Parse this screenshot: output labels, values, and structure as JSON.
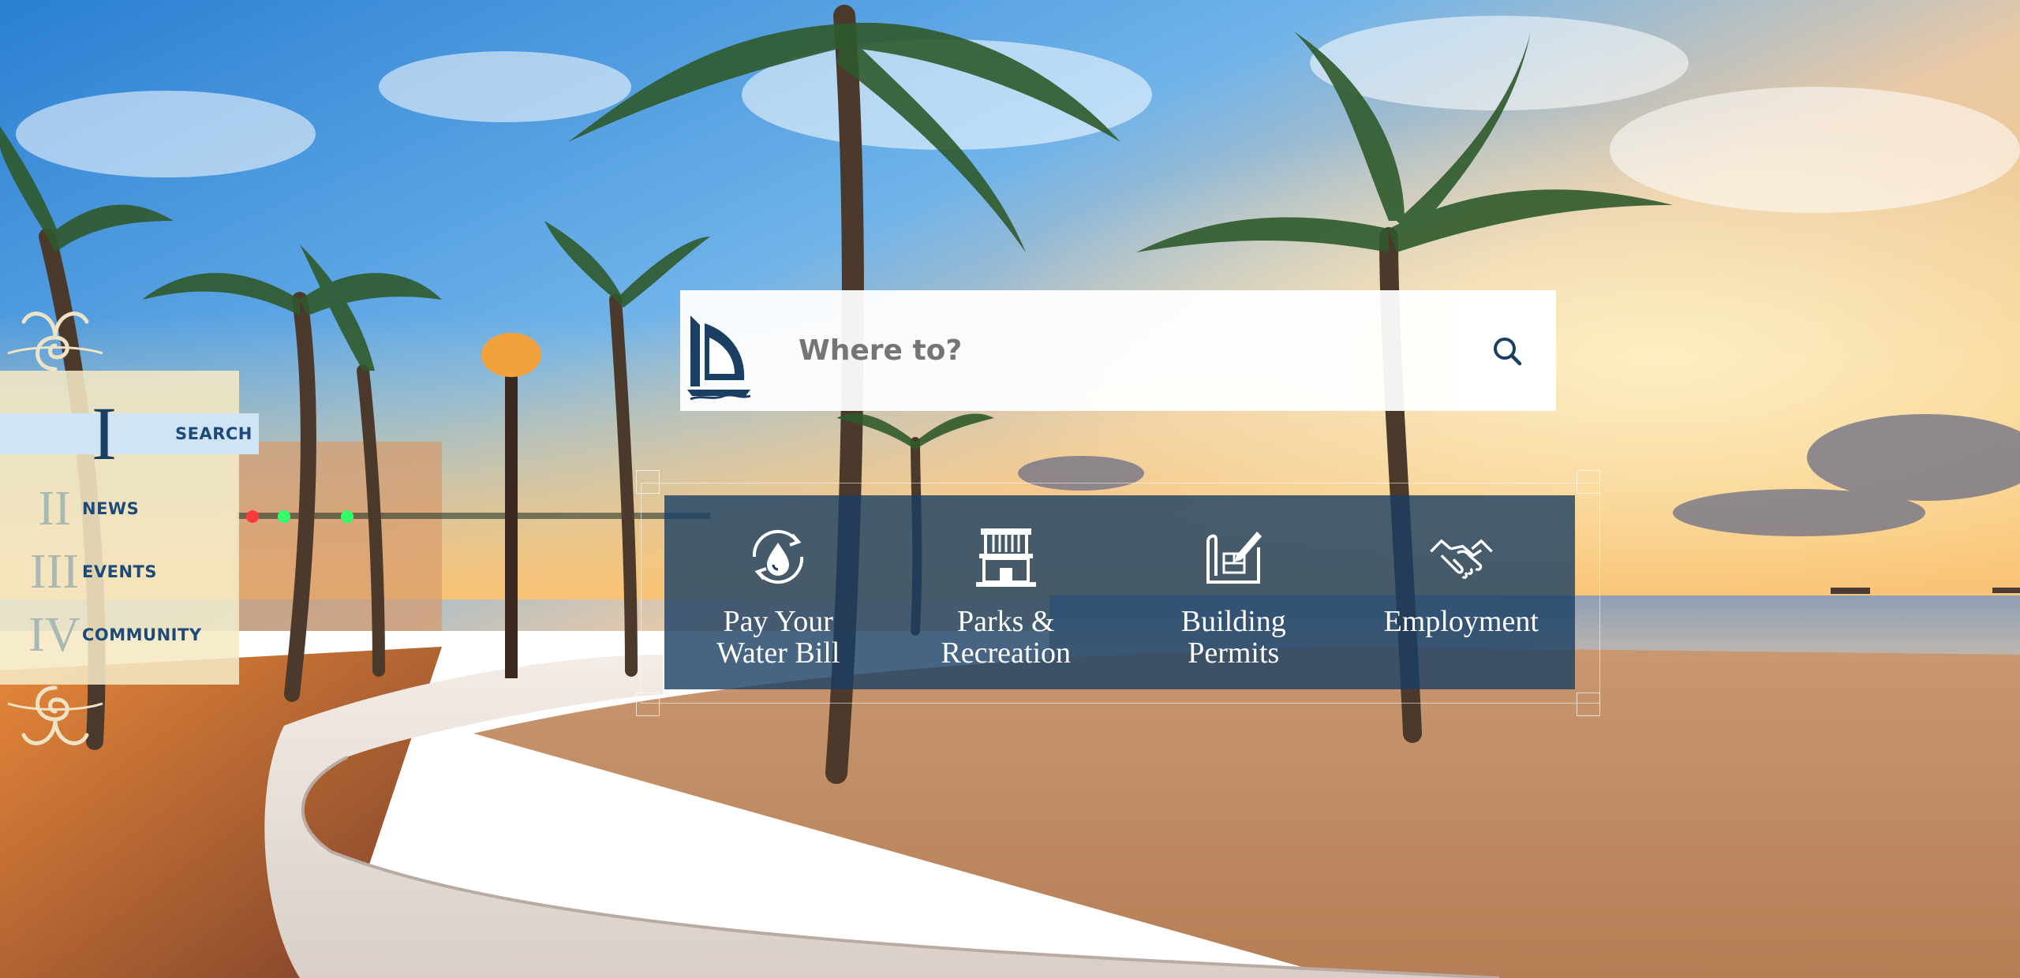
{
  "nav": {
    "items": [
      {
        "numeral": "I",
        "label": "SEARCH",
        "active": true
      },
      {
        "numeral": "II",
        "label": "NEWS",
        "active": false
      },
      {
        "numeral": "III",
        "label": "EVENTS",
        "active": false
      },
      {
        "numeral": "IV",
        "label": "COMMUNITY",
        "active": false
      }
    ]
  },
  "search": {
    "placeholder": "Where to?",
    "button_icon": "search-icon",
    "logo_icon": "sailboat-logo-icon"
  },
  "quick_links": [
    {
      "label_line1": "Pay Your",
      "label_line2": "Water Bill",
      "icon": "water-drop-recycle-icon"
    },
    {
      "label_line1": "Parks &",
      "label_line2": "Recreation",
      "icon": "lifeguard-tower-icon"
    },
    {
      "label_line1": "Building",
      "label_line2": "Permits",
      "icon": "blueprint-icon"
    },
    {
      "label_line1": "Employment",
      "label_line2": "",
      "icon": "handshake-icon"
    }
  ],
  "colors": {
    "navy": "#1b3e63",
    "panel_blue": "#193e64",
    "menu_cream": "#f5e8c4",
    "active_blue": "#cfe4f5"
  }
}
